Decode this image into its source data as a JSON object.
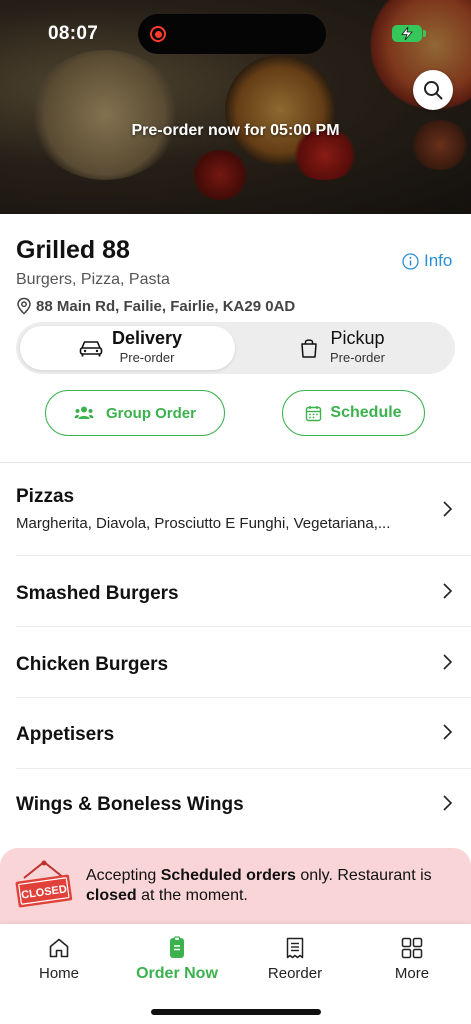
{
  "status_bar": {
    "time": "08:07"
  },
  "hero": {
    "preorder_banner": "Pre-order now for 05:00 PM"
  },
  "restaurant": {
    "name": "Grilled 88",
    "cuisine": "Burgers, Pizza, Pasta",
    "address": "88 Main Rd, Failie, Fairlie, KA29 0AD",
    "info_label": "Info"
  },
  "mode_toggle": {
    "delivery_label": "Delivery",
    "delivery_sub": "Pre-order",
    "pickup_label": "Pickup",
    "pickup_sub": "Pre-order",
    "selected": "Delivery"
  },
  "actions": {
    "group_order": "Group Order",
    "schedule": "Schedule"
  },
  "categories": [
    {
      "name": "Pizzas",
      "description": "Margherita, Diavola, Prosciutto E Funghi, Vegetariana,..."
    },
    {
      "name": "Smashed Burgers",
      "description": ""
    },
    {
      "name": "Chicken Burgers",
      "description": ""
    },
    {
      "name": "Appetisers",
      "description": ""
    },
    {
      "name": "Wings & Boneless Wings",
      "description": ""
    }
  ],
  "closed_notice": {
    "badge": "CLOSED",
    "text_1": "Accepting ",
    "text_bold_1": "Scheduled orders",
    "text_2": " only. Restaurant is ",
    "text_bold_2": "closed",
    "text_3": " at the moment."
  },
  "tabbar": {
    "items": [
      {
        "label": "Home",
        "icon": "home-icon"
      },
      {
        "label": "Order Now",
        "icon": "order-icon"
      },
      {
        "label": "Reorder",
        "icon": "receipt-icon"
      },
      {
        "label": "More",
        "icon": "grid-icon"
      }
    ],
    "active": "Order Now"
  },
  "colors": {
    "accent_green": "#3cb24f",
    "info_blue": "#2a8fd6",
    "closed_bg": "#f9d5d7",
    "closed_badge": "#e0413a"
  }
}
